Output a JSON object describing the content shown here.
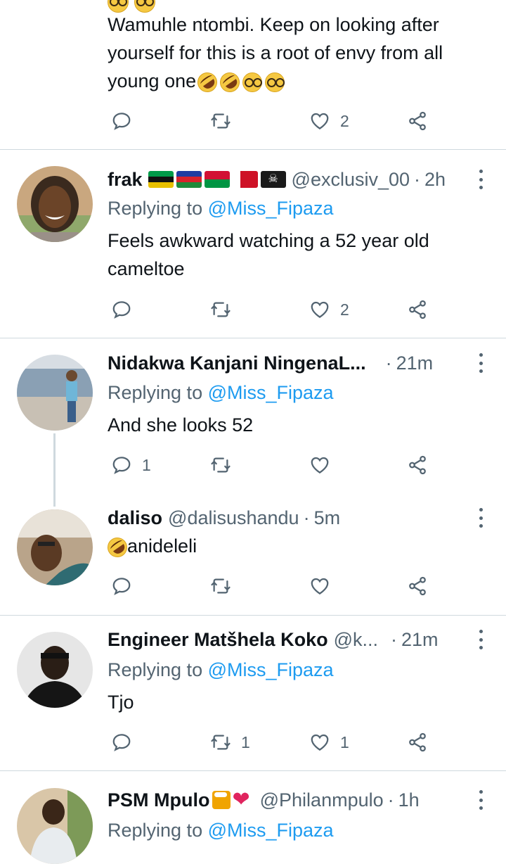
{
  "colors": {
    "accent": "#1d9bf0",
    "muted": "#536471",
    "text": "#0f1419",
    "divider": "#cfd9de"
  },
  "top_tweet": {
    "text_lines": [
      "Wamuhle ntombi. Keep on looking after",
      "yourself for this is a root of envy from all",
      "young one"
    ],
    "trailing_emoji": [
      "rolling-on-floor-laughing",
      "rolling-on-floor-laughing",
      "nerd-face",
      "nerd-face"
    ],
    "actions": {
      "reply_count": "",
      "retweet_count": "",
      "like_count": "2"
    }
  },
  "tweets": [
    {
      "name": "frak",
      "handle": "@exclusiv_00",
      "time": "2h",
      "flags": [
        "mozambique-flag",
        "new-caledonia-flag",
        "vanuatu-flag",
        "bahrain-flag",
        "pirate-flag"
      ],
      "replying_prefix": "Replying to",
      "replying_to": "@Miss_Fipaza",
      "text_lines": [
        "Feels awkward watching a 52 year old",
        "cameltoe"
      ],
      "actions": {
        "reply_count": "",
        "retweet_count": "",
        "like_count": "2"
      }
    },
    {
      "name": "Nidakwa Kanjani NingenaL...",
      "handle": "",
      "time": "21m",
      "replying_prefix": "Replying to",
      "replying_to": "@Miss_Fipaza",
      "text_lines": [
        "And she looks 52"
      ],
      "actions": {
        "reply_count": "1",
        "retweet_count": "",
        "like_count": ""
      }
    },
    {
      "name": "daliso",
      "handle": "@dalisushandu",
      "time": "5m",
      "text": "anideleli",
      "leading_emoji": "rolling-on-floor-laughing",
      "actions": {
        "reply_count": "",
        "retweet_count": "",
        "like_count": ""
      }
    },
    {
      "name": "Engineer Matšhela Koko",
      "handle": "@k...",
      "time": "21m",
      "replying_prefix": "Replying to",
      "replying_to": "@Miss_Fipaza",
      "text_lines": [
        "Tjo"
      ],
      "actions": {
        "reply_count": "",
        "retweet_count": "1",
        "like_count": "1"
      }
    },
    {
      "name": "PSM Mpulo",
      "handle": "@Philanmpulo",
      "time": "1h",
      "name_emoji": [
        "clinking-beer-mugs",
        "red-heart"
      ],
      "replying_prefix": "Replying to",
      "replying_to": "@Miss_Fipaza"
    }
  ],
  "separator": "·"
}
